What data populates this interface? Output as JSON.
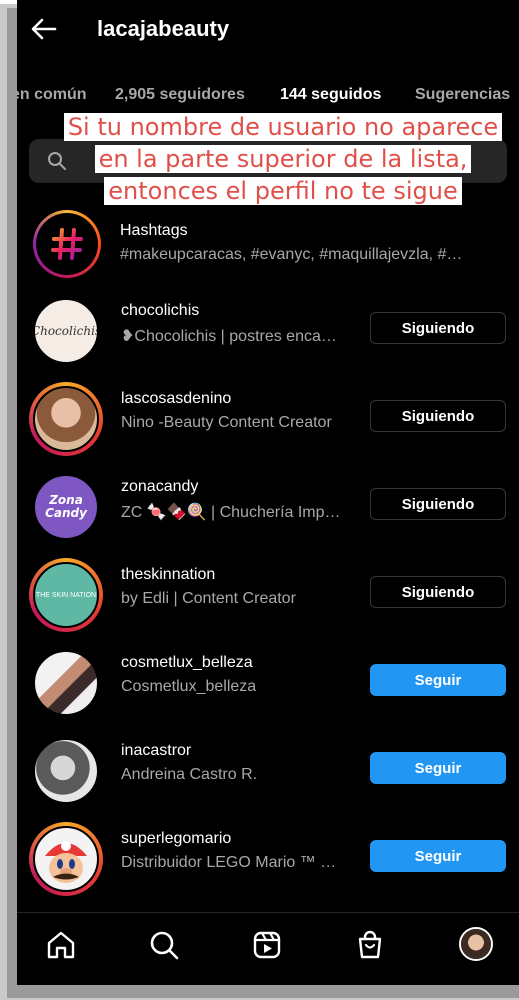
{
  "header": {
    "title": "lacajabeauty"
  },
  "tabs": [
    {
      "label": "en común"
    },
    {
      "label": "2,905 seguidores"
    },
    {
      "label": "144 seguidos"
    },
    {
      "label": "Sugerencias"
    }
  ],
  "search": {
    "placeholder": ""
  },
  "overlay": {
    "lines": [
      "Si tu nombre de usuario no aparece",
      "en la parte superior de la lista,",
      "entonces el perfil no te sigue"
    ]
  },
  "hashtags": {
    "title": "Hashtags",
    "subtitle": "#makeupcaracas, #evanyc, #maquillajevzla, #…"
  },
  "accounts": [
    {
      "username": "chocolichis",
      "name": "❥Chocolichis | postres enca…",
      "button": "Siguiendo",
      "avatar_text": "Chocolichis"
    },
    {
      "username": "lascosasdenino",
      "name": "Nino -Beauty Content Creator",
      "button": "Siguiendo",
      "avatar_text": ""
    },
    {
      "username": "zonacandy",
      "name": "ZC 🍬🍫🍭 | Chuchería Imp…",
      "button": "Siguiendo",
      "avatar_text": "Zona Candy"
    },
    {
      "username": "theskinnation",
      "name": "by Edli | Content Creator",
      "button": "Siguiendo",
      "avatar_text": "THE SKIN NATION"
    },
    {
      "username": "cosmetlux_belleza",
      "name": "Cosmetlux_belleza",
      "button": "Seguir",
      "avatar_text": ""
    },
    {
      "username": "inacastror",
      "name": "Andreina Castro R.",
      "button": "Seguir",
      "avatar_text": ""
    },
    {
      "username": "superlegomario",
      "name": "Distribuidor LEGO Mario ™ …",
      "button": "Seguir",
      "avatar_text": ""
    }
  ],
  "colors": {
    "background": "#000000",
    "follow_button": "#2196f3",
    "overlay_text": "#e0504b"
  },
  "nav": {
    "icons": [
      "home-icon",
      "search-icon",
      "reels-icon",
      "shop-icon",
      "profile-avatar"
    ]
  }
}
